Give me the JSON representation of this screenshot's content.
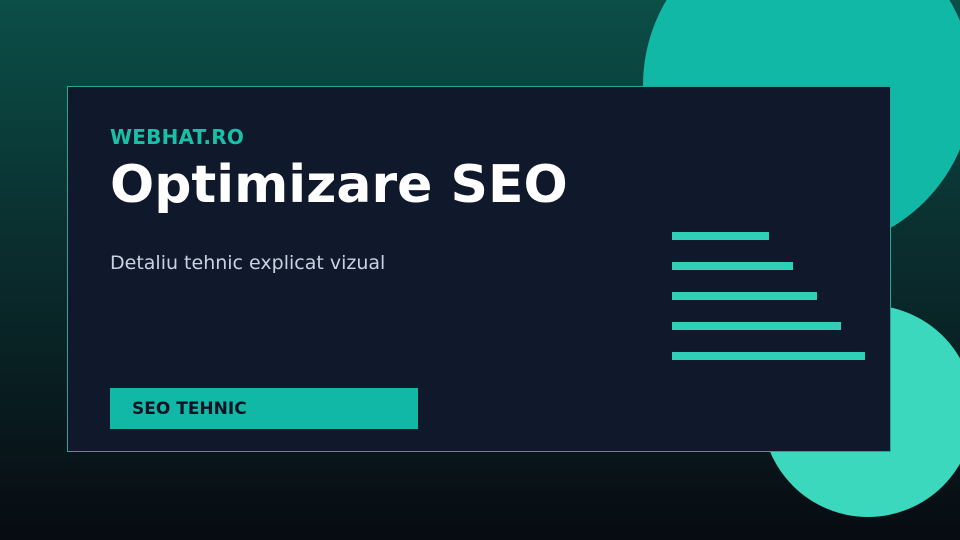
{
  "colors": {
    "accent": "#12b8a6",
    "accent_light": "#3cd8be",
    "card_background": "#10182b",
    "text_primary": "#ffffff",
    "text_secondary": "#c9d2df"
  },
  "card": {
    "brand": "WEBHAT.RO",
    "title": "Optimizare SEO",
    "subtitle": "Detaliu tehnic explicat vizual",
    "tag": "SEO TEHNIC"
  },
  "decor": {
    "bar_icon": "horizontal-bars-icon",
    "bar_lengths": [
      0.5,
      0.625,
      0.75,
      0.875,
      1.0
    ]
  }
}
